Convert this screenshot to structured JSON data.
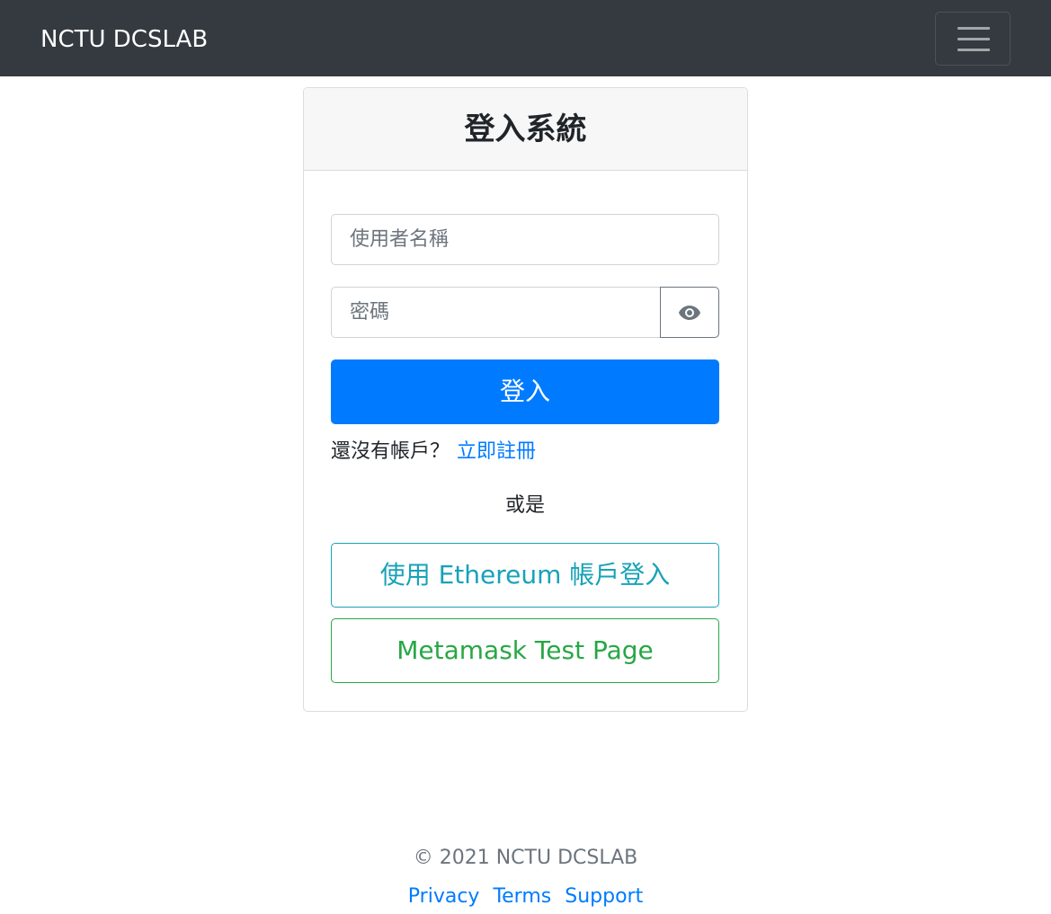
{
  "navbar": {
    "brand": "NCTU DCSLAB",
    "toggler_icon": "hamburger-menu-icon"
  },
  "login": {
    "title": "登入系統",
    "username_placeholder": "使用者名稱",
    "password_placeholder": "密碼",
    "show_password_icon": "eye-icon",
    "submit_label": "登入",
    "no_account_text": "還沒有帳戶？",
    "register_link": "立即註冊",
    "or_text": "或是",
    "ethereum_button": "使用 Ethereum 帳戶登入",
    "metamask_button": "Metamask Test Page"
  },
  "footer": {
    "copyright": "© 2021 NCTU DCSLAB",
    "links": [
      "Privacy",
      "Terms",
      "Support"
    ]
  },
  "colors": {
    "navbar_bg": "#343a40",
    "primary": "#007bff",
    "info": "#17a2b8",
    "success": "#28a745"
  }
}
